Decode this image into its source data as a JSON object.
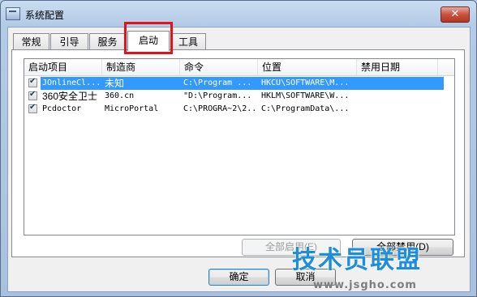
{
  "window": {
    "title": "系统配置",
    "close_label": "✕"
  },
  "tabs": [
    {
      "label": "常规"
    },
    {
      "label": "引导"
    },
    {
      "label": "服务"
    },
    {
      "label": "启动",
      "active": true
    },
    {
      "label": "工具"
    }
  ],
  "list": {
    "columns": [
      "启动项目",
      "制造商",
      "命令",
      "位置",
      "禁用日期"
    ],
    "rows": [
      {
        "checked": true,
        "item": "JOnlineCl...",
        "maker": "未知",
        "command": "C:\\Program ...",
        "location": "HKCU\\SOFTWARE\\M...",
        "disabled_date": "",
        "selected": true
      },
      {
        "checked": true,
        "item": "360安全卫士",
        "maker": "360.cn",
        "command": "\"D:\\Program...",
        "location": "HKLM\\SOFTWARE\\W...",
        "disabled_date": ""
      },
      {
        "checked": true,
        "item": "Pcdoctor",
        "maker": "MicroPortal",
        "command": "C:\\PROGRA~2\\2...",
        "location": "C:\\ProgramData\\...",
        "disabled_date": ""
      }
    ]
  },
  "buttons": {
    "enable_all": "全部启用(E)",
    "disable_all": "全部禁用(D)",
    "ok": "确定",
    "cancel": "取消"
  },
  "watermark": {
    "text": "技术员联盟",
    "url": "www.jsgho.com"
  },
  "colors": {
    "selection": "#3399ff",
    "highlight_box": "#e0121c",
    "watermark": "#1e8ed8"
  }
}
